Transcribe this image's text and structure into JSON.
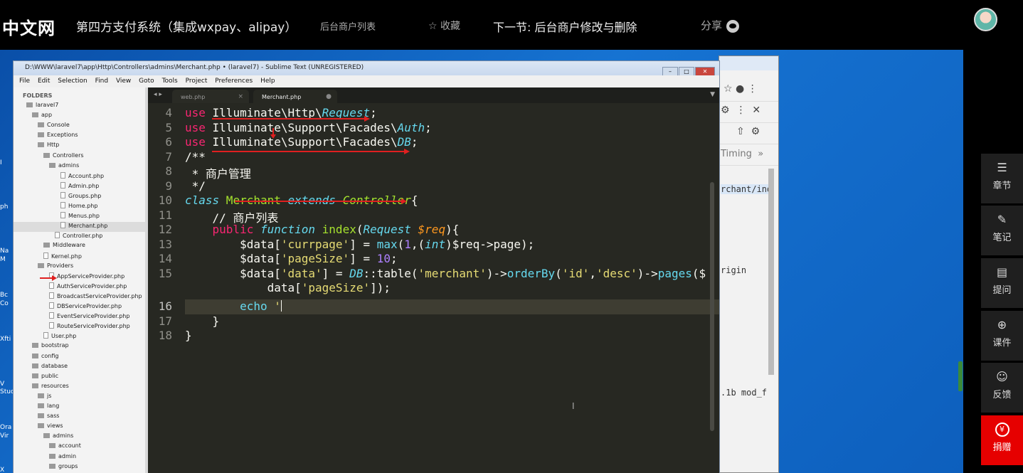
{
  "topbar": {
    "logo": "中文网",
    "course_title": "第四方支付系统（集成wxpay、alipay）",
    "current_lesson": "后台商户列表",
    "favorite": "收藏",
    "next_lesson": "下一节: 后台商户修改与删除",
    "share": "分享"
  },
  "sublime": {
    "title": "D:\\WWW\\laravel7\\app\\Http\\Controllers\\admins\\Merchant.php • (laravel7) - Sublime Text (UNREGISTERED)",
    "menu": [
      "File",
      "Edit",
      "Selection",
      "Find",
      "View",
      "Goto",
      "Tools",
      "Project",
      "Preferences",
      "Help"
    ],
    "tabs": [
      {
        "label": "web.php",
        "close": "×"
      },
      {
        "label": "Merchant.php",
        "close": "●"
      }
    ],
    "sidebar_header": "FOLDERS",
    "tree": [
      "laravel7",
      "app",
      "Console",
      "Exceptions",
      "Http",
      "Controllers",
      "admins",
      "Account.php",
      "Admin.php",
      "Groups.php",
      "Home.php",
      "Menus.php",
      "Merchant.php",
      "Controller.php",
      "Middleware",
      "Kernel.php",
      "Providers",
      "AppServiceProvider.php",
      "AuthServiceProvider.php",
      "BroadcastServiceProvider.php",
      "DBServiceProvider.php",
      "EventServiceProvider.php",
      "RouteServiceProvider.php",
      "User.php",
      "bootstrap",
      "config",
      "database",
      "public",
      "resources",
      "js",
      "lang",
      "sass",
      "views",
      "admins",
      "account",
      "admin",
      "groups"
    ],
    "line_numbers": [
      "4",
      "5",
      "6",
      "7",
      "8",
      "9",
      "10",
      "11",
      "12",
      "13",
      "14",
      "15",
      "",
      "16",
      "17",
      "18"
    ],
    "code": {
      "l4_use": "use",
      "l4_ns": " Illuminate\\Http\\",
      "l4_cls": "Request",
      "l4_end": ";",
      "l5_use": "use",
      "l5_ns": " Illuminate\\Support\\Facades\\",
      "l5_cls": "Auth",
      "l5_end": ";",
      "l6_use": "use",
      "l6_ns": " Illuminate\\Support\\Facades\\",
      "l6_cls": "DB",
      "l6_end": ";",
      "l7": "/**",
      "l8": " * 商户管理",
      "l9": " */",
      "l10_class": "class",
      "l10_name": " Merchant",
      "l10_ext": " extends",
      "l10_parent": " Controller",
      "l10_end": "{",
      "l11": "    // 商户列表",
      "l12_pub": "    public",
      "l12_fn": " function",
      "l12_name": " index",
      "l12_p1": "(",
      "l12_type": "Request",
      "l12_var": " $req",
      "l12_end": "){",
      "l13_a": "        $data[",
      "l13_k": "'currpage'",
      "l13_b": "] = ",
      "l13_fn": "max",
      "l13_c": "(",
      "l13_n": "1",
      "l13_d": ",(",
      "l13_t": "int",
      "l13_e": ")$req->page);",
      "l14_a": "        $data[",
      "l14_k": "'pageSize'",
      "l14_b": "] = ",
      "l14_n": "10",
      "l14_e": ";",
      "l15_a": "        $data[",
      "l15_k": "'data'",
      "l15_b": "] = ",
      "l15_db": "DB",
      "l15_c": "::table(",
      "l15_t": "'merchant'",
      "l15_d": ")->",
      "l15_fn": "orderBy",
      "l15_e": "(",
      "l15_id": "'id'",
      "l15_f": ",",
      "l15_desc": "'desc'",
      "l15_g": ")->",
      "l15_pg": "pages",
      "l15_h": "($",
      "l15b_a": "            data[",
      "l15b_k": "'pageSize'",
      "l15b_e": "]);",
      "l16_echo": "        echo",
      "l16_q": " '",
      "l17": "    }",
      "l18": "}"
    }
  },
  "chrome": {
    "timing": "Timing",
    "code_1": "rchant/ind",
    "code_2": "rigin",
    "code_3": ".1b mod_f"
  },
  "right_panel": {
    "chapters": "章节",
    "notes": "笔记",
    "questions": "提问",
    "courseware": "课件",
    "feedback": "反馈",
    "donate": "捐赠"
  },
  "desktop_labels": [
    "I",
    "ph",
    "Na",
    "M",
    "Bc",
    "Co",
    "Xfti",
    "V",
    "Stuc",
    "Ora",
    "Vir",
    "X"
  ],
  "colors": {
    "accent": "#e60000",
    "editor_bg": "#272822",
    "keyword": "#f92672",
    "string": "#e6db74",
    "function": "#a6e22e",
    "type": "#66d9ef",
    "number": "#ae81ff"
  }
}
